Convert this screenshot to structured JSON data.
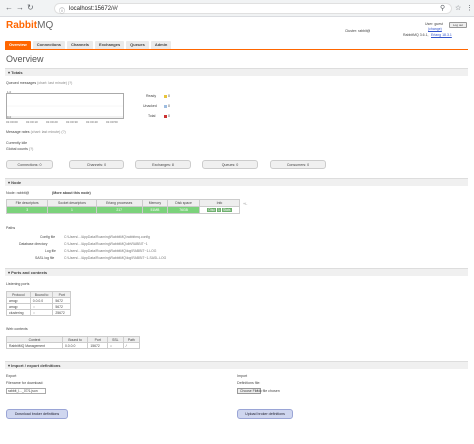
{
  "browser": {
    "url": "localhost:15672/#/",
    "back_icon": "arrow-left",
    "forward_icon": "arrow-right",
    "reload_icon": "reload",
    "info_icon": "info-circle",
    "search_icon": "magnifier",
    "star_icon": "star",
    "menu_icon": "ellipsis"
  },
  "header": {
    "logo_main": "Rabbit",
    "logo_suffix": "MQ",
    "cluster_label": "Cluster: rabbit@",
    "cluster_value": "",
    "user_label": "User: guest",
    "change_link": "(change)",
    "version_text": "RabbitMQ 3.6.1,",
    "erlang_link": "Erlang 18.3.1",
    "logout": "Log out"
  },
  "tabs": [
    "Overview",
    "Connections",
    "Channels",
    "Exchanges",
    "Queues",
    "Admin"
  ],
  "page_title": "Overview",
  "totals": {
    "header": "Totals",
    "queued_label": "Queued messages",
    "queued_hint": "(chart: last minute) (?)",
    "y_top": "1.0",
    "y_bottom": "0.0",
    "x_ticks": [
      "01:00:00",
      "01:00:10",
      "01:00:20",
      "01:00:30",
      "01:00:40",
      "01:00:50"
    ],
    "legend": [
      {
        "label": "Ready",
        "value": "0",
        "color": "#e8c43c"
      },
      {
        "label": "Unacked",
        "value": "0",
        "color": "#9ebde0"
      },
      {
        "label": "Total",
        "value": "0",
        "color": "#cc3333"
      }
    ],
    "message_rates_label": "Message rates",
    "message_rates_hint": "(chart: last minute) (?)",
    "currently_idle": "Currently idle",
    "global_counts_label": "Global counts",
    "global_counts_hint": "(?)"
  },
  "objects": [
    {
      "label": "Connections: 0"
    },
    {
      "label": "Channels: 0"
    },
    {
      "label": "Exchanges: 8"
    },
    {
      "label": "Queues: 0"
    },
    {
      "label": "Consumers: 0"
    }
  ],
  "node": {
    "header": "Node",
    "node_label": "Node: rabbit@",
    "more_about": "(More about this node)",
    "columns": [
      "File descriptors",
      "Socket descriptors",
      "Erlang processes",
      "Memory",
      "Disk space",
      "Info"
    ],
    "values": [
      "3",
      "1",
      "217",
      "51MB",
      "76GB",
      ""
    ],
    "info_tags": [
      "Disc",
      "1",
      "Stats"
    ],
    "plus_minus": "+/-",
    "paths_label": "Paths",
    "paths": [
      {
        "name": "Config file",
        "value": "C:\\Users\\...\\AppData\\Roaming\\RabbitMQ\\rabbitmq.config"
      },
      {
        "name": "Database directory",
        "value": "C:\\Users\\...\\AppData\\Roaming\\RabbitMQ\\db\\RABBIT~1"
      },
      {
        "name": "Log file",
        "value": "C:\\Users\\...\\AppData\\Roaming\\RabbitMQ\\log\\RABBIT~1.LOG"
      },
      {
        "name": "SASL log file",
        "value": "C:\\Users\\...\\AppData\\Roaming\\RabbitMQ\\log\\RABBIT~1-SASL.LOG"
      }
    ]
  },
  "ports": {
    "header": "Ports and contexts",
    "listening_label": "Listening ports",
    "columns": [
      "Protocol",
      "Bound to",
      "Port"
    ],
    "rows": [
      [
        "amqp",
        "0.0.0.0",
        "5672"
      ],
      [
        "amqp",
        "::",
        "5672"
      ],
      [
        "clustering",
        "::",
        "25672"
      ]
    ],
    "web_label": "Web contexts",
    "web_columns": [
      "Context",
      "Bound to",
      "Port",
      "SSL",
      "Path"
    ],
    "web_rows": [
      [
        "RabbitMQ Management",
        "0.0.0.0",
        "15672",
        "○",
        "/"
      ]
    ]
  },
  "import_export": {
    "header": "Import / export definitions",
    "export_label": "Export",
    "filename_label": "Filename for download:",
    "filename_value": "rabbit_l..._07/1.json",
    "download_btn": "Download broker definitions",
    "import_label": "Import",
    "definitions_label": "Definitions file:",
    "choose_btn": "Choose File",
    "no_file": "No file chosen",
    "upload_btn": "Upload broker definitions"
  },
  "colors": {
    "accent": "#ff6600",
    "green": "#7bd27b"
  }
}
